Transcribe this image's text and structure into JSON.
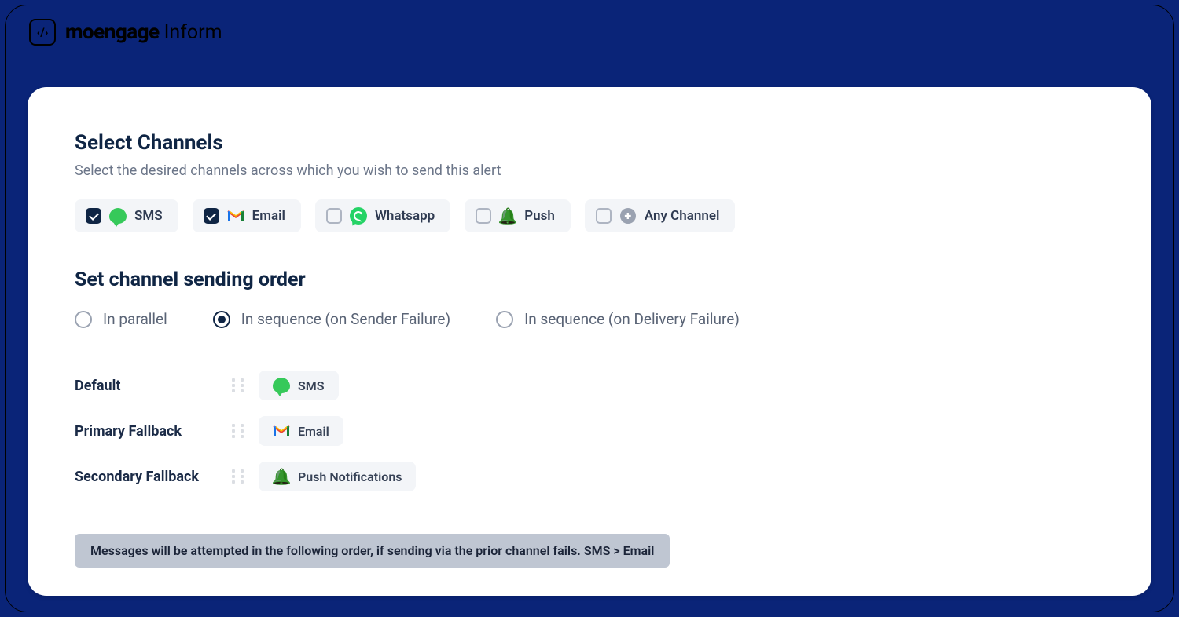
{
  "brand": {
    "name": "moengage",
    "product": "Inform",
    "mark": "‹/›"
  },
  "section1": {
    "title": "Select Channels",
    "subtitle": "Select the desired channels across which you wish to send this alert"
  },
  "channels": [
    {
      "label": "SMS",
      "icon": "sms",
      "checked": true
    },
    {
      "label": "Email",
      "icon": "gmail",
      "checked": true
    },
    {
      "label": "Whatsapp",
      "icon": "whatsapp",
      "checked": false
    },
    {
      "label": "Push",
      "icon": "push",
      "checked": false
    },
    {
      "label": "Any Channel",
      "icon": "plus",
      "checked": false
    }
  ],
  "section2": {
    "title": "Set channel sending order"
  },
  "order_modes": [
    {
      "label": "In parallel",
      "selected": false
    },
    {
      "label": "In sequence (on Sender Failure)",
      "selected": true
    },
    {
      "label": "In sequence (on Delivery Failure)",
      "selected": false
    }
  ],
  "order_rows": [
    {
      "role": "Default",
      "label": "SMS",
      "icon": "sms"
    },
    {
      "role": "Primary Fallback",
      "label": "Email",
      "icon": "gmail"
    },
    {
      "role": "Secondary Fallback",
      "label": "Push Notifications",
      "icon": "push"
    }
  ],
  "banner": "Messages will be attempted in the following order, if sending via the prior channel fails. SMS > Email"
}
